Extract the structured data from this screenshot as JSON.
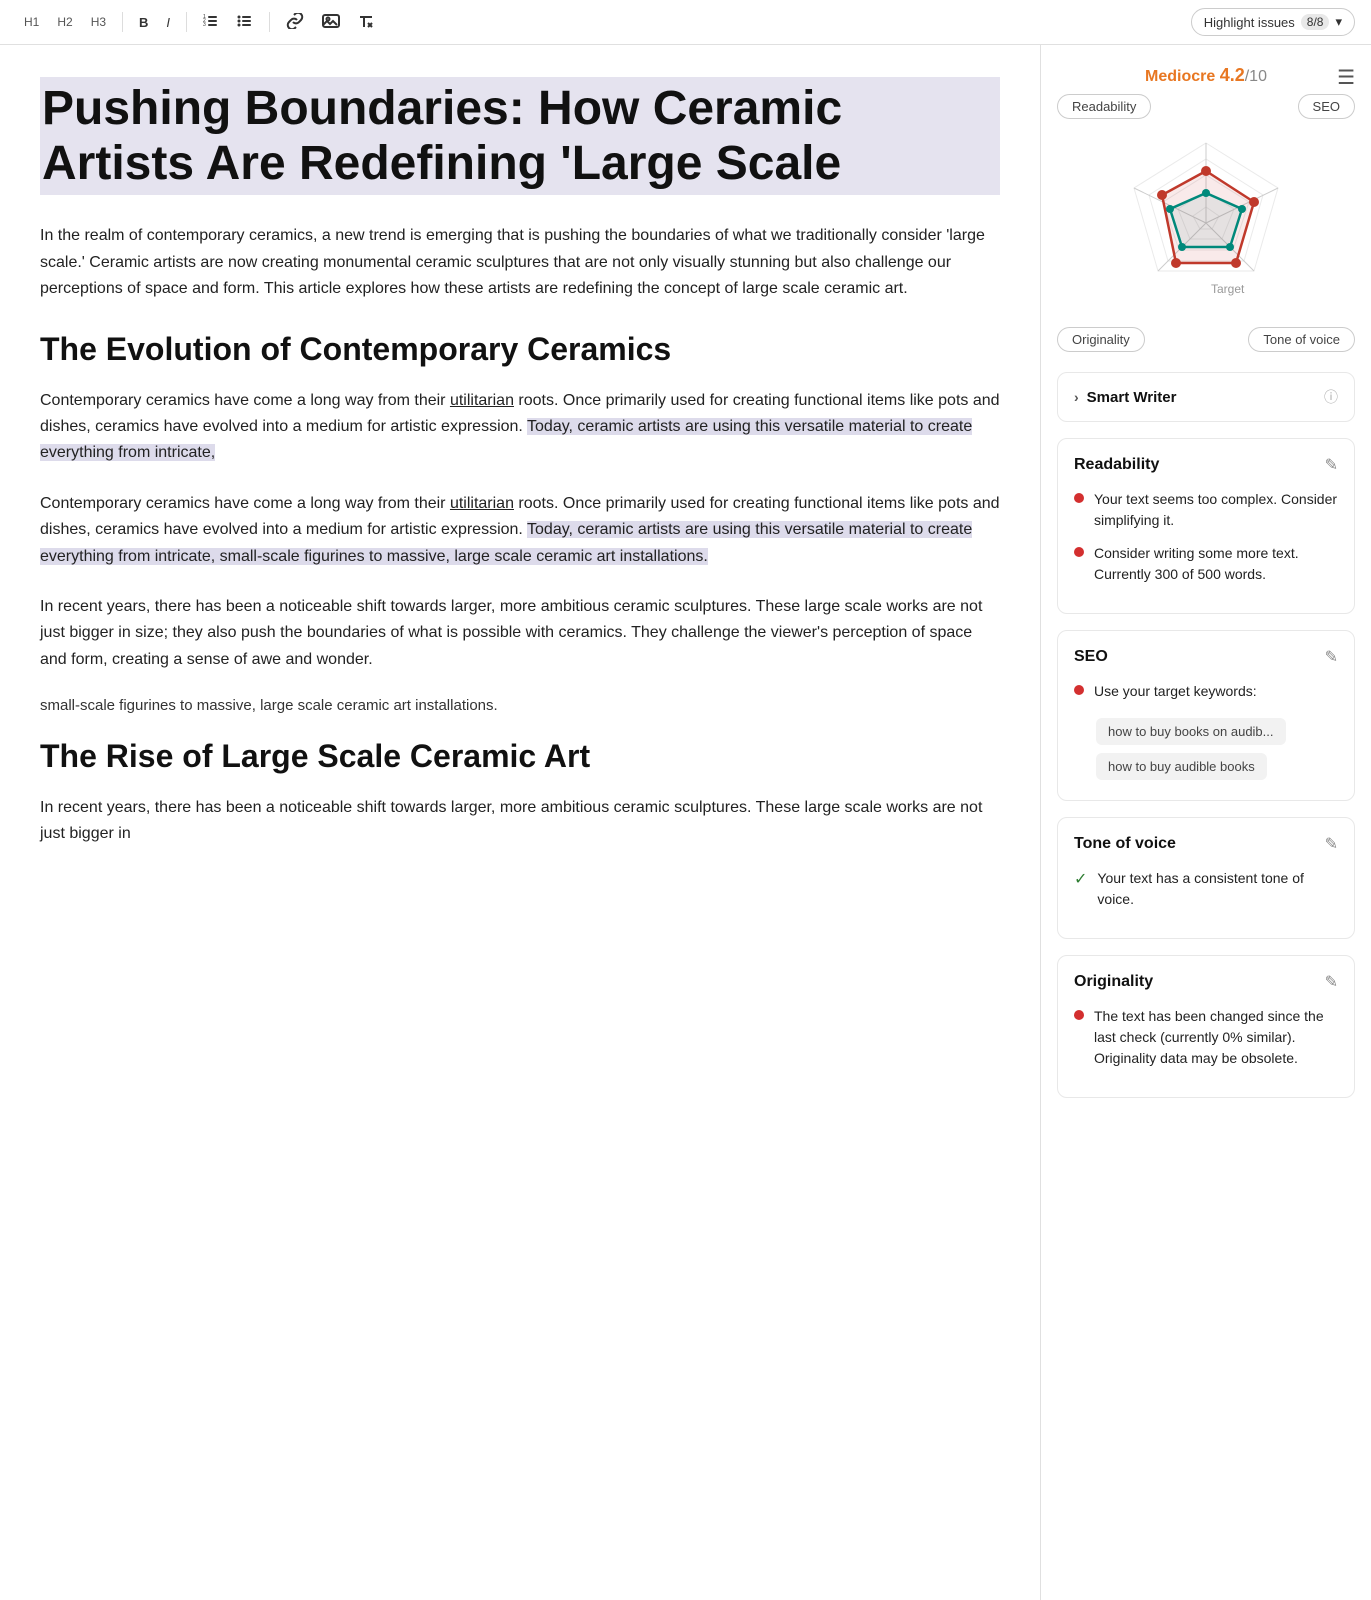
{
  "toolbar": {
    "h1_label": "H1",
    "h2_label": "H2",
    "h3_label": "H3",
    "bold_label": "B",
    "italic_label": "I",
    "list_ordered_icon": "list-ordered-icon",
    "list_unordered_icon": "list-unordered-icon",
    "link_icon": "link-icon",
    "image_icon": "image-icon",
    "clear_format_icon": "clear-format-icon",
    "highlight_label": "Highlight issues",
    "highlight_count": "8/8",
    "chevron_icon": "chevron-down-icon"
  },
  "article": {
    "title": "Pushing Boundaries: How Ceramic Artists Are Redefining 'Large Scale",
    "intro": "In the realm of contemporary ceramics, a new trend is emerging that is pushing the boundaries of what we traditionally consider 'large scale.' Ceramic artists are now creating monumental ceramic sculptures that are not only visually stunning but also challenge our perceptions of space and form. This article explores how these artists are redefining the concept of large scale ceramic art.",
    "section1_heading": "The Evolution of Contemporary Ceramics",
    "para1": "Contemporary ceramics have come a long way from their utilitarian roots. Once primarily used for creating functional items like pots and dishes, ceramics have evolved into a medium for artistic expression. Today, ceramic artists are using this versatile material to create everything from intricate,",
    "para2": "Contemporary ceramics have come a long way from their utilitarian roots. Once primarily used for creating functional items like pots and dishes, ceramics have evolved into a medium for artistic expression. Today, ceramic artists are using this versatile material to create everything from intricate, small-scale figurines to massive, large scale ceramic art installations.",
    "para3": "In recent years, there has been a noticeable shift towards larger, more ambitious ceramic sculptures. These large scale works are not just bigger in size; they also push the boundaries of what is possible with ceramics. They challenge the viewer's perception of space and form, creating a sense of awe and wonder.",
    "small_text": "small-scale figurines to massive, large scale ceramic art installations.",
    "section2_heading": "The Rise of Large Scale Ceramic Art",
    "para4": "In recent years, there has been a noticeable shift towards larger, more ambitious ceramic sculptures. These large scale works are not just bigger in"
  },
  "sidebar": {
    "menu_icon": "menu-icon",
    "score": {
      "label_mediocre": "Mediocre",
      "score_num": "4.2",
      "score_denom": "/10"
    },
    "radar_tags": {
      "readability": "Readability",
      "seo": "SEO",
      "originality": "Originality",
      "tone_of_voice": "Tone of voice"
    },
    "target_label": "Target",
    "smart_writer": {
      "label": "Smart Writer",
      "chevron": "›",
      "info": "i"
    },
    "readability": {
      "title": "Readability",
      "items": [
        "Your text seems too complex. Consider simplifying it.",
        "Consider writing some more text. Currently 300 of 500 words."
      ]
    },
    "seo": {
      "title": "SEO",
      "intro": "Use your target keywords:",
      "keywords": [
        "how to buy books on audib...",
        "how to buy audible books"
      ]
    },
    "tone_of_voice": {
      "title": "Tone of voice",
      "item": "Your text has a consistent tone of voice."
    },
    "originality": {
      "title": "Originality",
      "item": "The text has been changed since the last check (currently 0% similar). Originality data may be obsolete."
    }
  }
}
